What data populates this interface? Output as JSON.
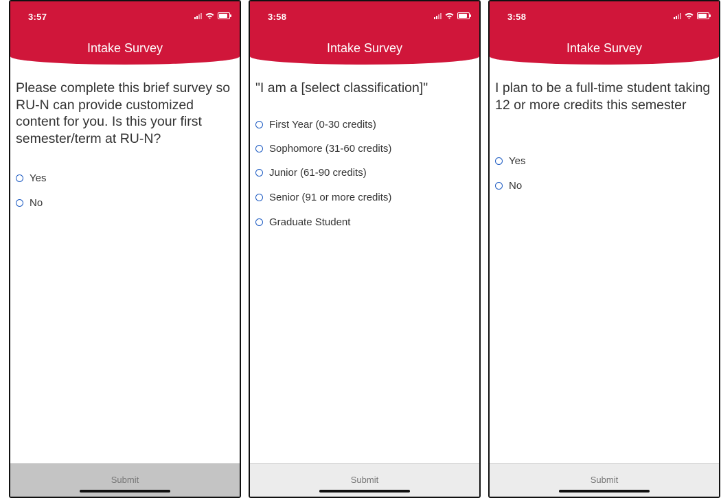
{
  "screens": [
    {
      "time": "3:57",
      "title": "Intake Survey",
      "question": "Please complete this brief survey so RU-N can provide customized content for you. Is this your first semester/term at RU-N?",
      "options": [
        "Yes",
        "No"
      ],
      "submit_label": "Submit",
      "submit_disabled": true
    },
    {
      "time": "3:58",
      "title": "Intake Survey",
      "question": "\"I am a [select classification]\"",
      "options": [
        "First Year (0-30 credits)",
        "Sophomore (31-60 credits)",
        "Junior (61-90 credits)",
        "Senior (91 or more credits)",
        "Graduate Student"
      ],
      "submit_label": "Submit",
      "submit_disabled": false
    },
    {
      "time": "3:58",
      "title": "Intake Survey",
      "question": "I plan to be a full-time student taking 12 or more credits this semester",
      "options": [
        "Yes",
        "No"
      ],
      "submit_label": "Submit",
      "submit_disabled": false
    }
  ],
  "colors": {
    "header": "#d0163a",
    "radio": "#1d5bc2"
  }
}
